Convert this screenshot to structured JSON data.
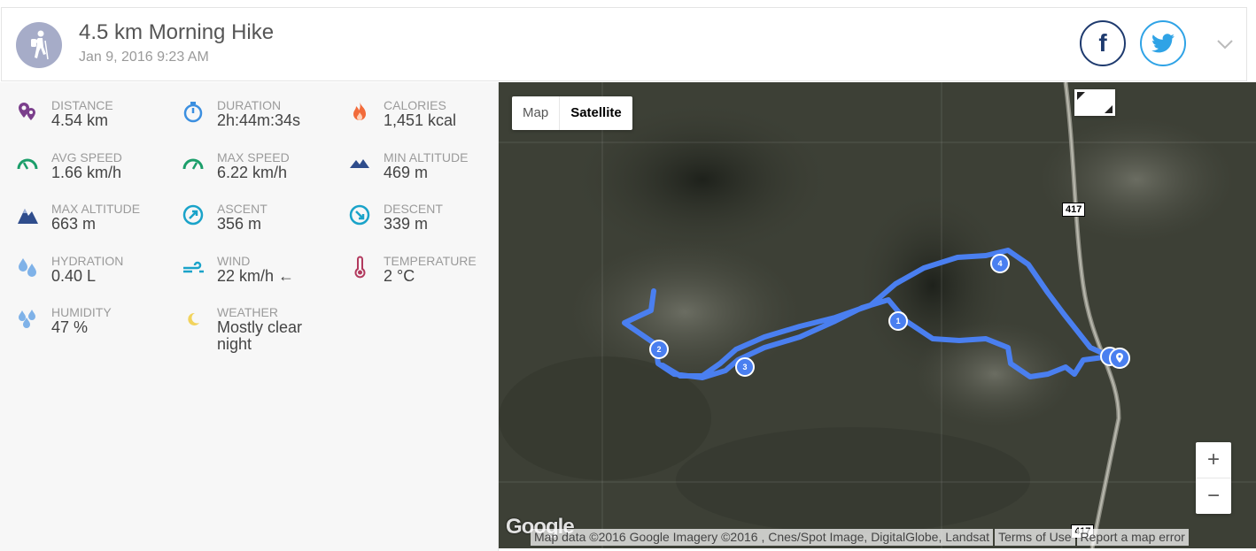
{
  "header": {
    "title": "4.5 km Morning Hike",
    "subtitle": "Jan 9, 2016 9:23 AM",
    "avatar_icon": "hiker-icon",
    "share": {
      "facebook_label": "f"
    }
  },
  "stats": [
    {
      "label": "DISTANCE",
      "value": "4.54 km",
      "icon": "location-pins-icon",
      "color": "#7b3f8c"
    },
    {
      "label": "DURATION",
      "value": "2h:44m:34s",
      "icon": "stopwatch-icon",
      "color": "#3b8fe0"
    },
    {
      "label": "CALORIES",
      "value": "1,451 kcal",
      "icon": "flame-icon",
      "color": "#f26b3a"
    },
    {
      "label": "AVG SPEED",
      "value": "1.66 km/h",
      "icon": "speedometer-icon",
      "color": "#1b9e6a"
    },
    {
      "label": "MAX SPEED",
      "value": "6.22 km/h",
      "icon": "speedometer-icon",
      "color": "#1b9e6a"
    },
    {
      "label": "MIN ALTITUDE",
      "value": "469 m",
      "icon": "mountain-icon",
      "color": "#2f4d8c"
    },
    {
      "label": "MAX ALTITUDE",
      "value": "663 m",
      "icon": "mountain-icon",
      "color": "#2f4d8c"
    },
    {
      "label": "ASCENT",
      "value": "356 m",
      "icon": "ascent-icon",
      "color": "#1aa3c9"
    },
    {
      "label": "DESCENT",
      "value": "339 m",
      "icon": "descent-icon",
      "color": "#1aa3c9"
    },
    {
      "label": "HYDRATION",
      "value": "0.40 L",
      "icon": "water-drops-icon",
      "color": "#7fb2e8"
    },
    {
      "label": "WIND",
      "value": "22 km/h ←",
      "icon": "wind-icon",
      "color": "#1aa3c9"
    },
    {
      "label": "TEMPERATURE",
      "value": "2 °C",
      "icon": "thermometer-icon",
      "color": "#b23a5e"
    },
    {
      "label": "HUMIDITY",
      "value": "47 %",
      "icon": "water-drops-icon",
      "color": "#7fb2e8"
    },
    {
      "label": "WEATHER",
      "value": "Mostly clear",
      "value2": "night",
      "icon": "moon-icon",
      "color": "#f2d35c"
    }
  ],
  "map": {
    "type_map": "Map",
    "type_satellite": "Satellite",
    "zoom_in": "+",
    "zoom_out": "−",
    "attribution": "Map data ©2016 Google Imagery ©2016 , Cnes/Spot Image, DigitalGlobe, Landsat",
    "terms": "Terms of Use",
    "report": "Report a map error",
    "logo": "Google",
    "road_label": "417",
    "road_label_bottom": "417",
    "markers": [
      "1",
      "2",
      "3",
      "4"
    ],
    "route_color": "#4a7ff0"
  }
}
